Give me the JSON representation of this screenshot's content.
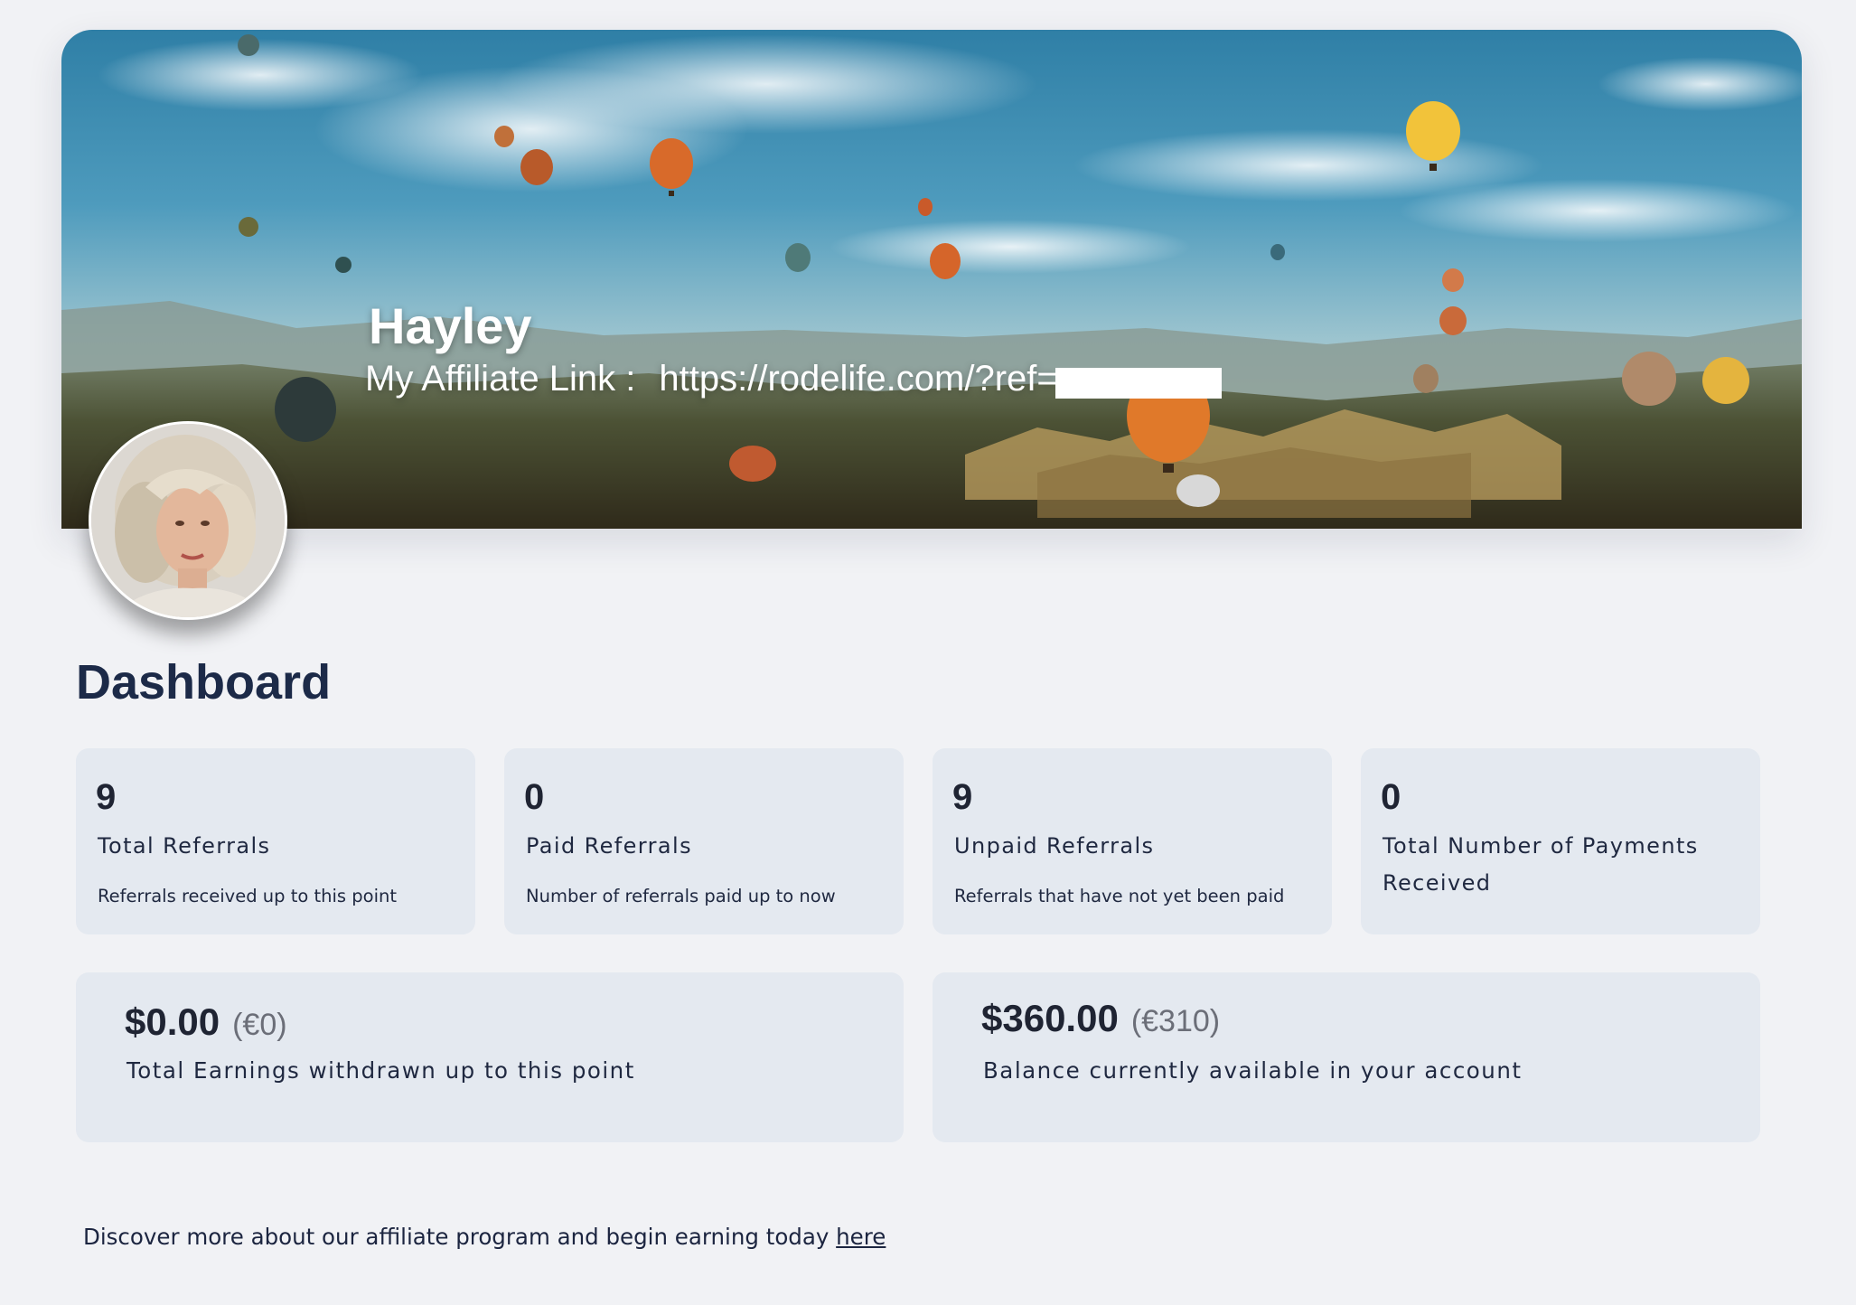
{
  "profile": {
    "name": "Hayley",
    "affiliate_link_label": "My Affiliate Link :",
    "affiliate_link_url": "https://rodelife.com/?ref="
  },
  "dashboard": {
    "title": "Dashboard",
    "stats": [
      {
        "value": "9",
        "label": "Total Referrals",
        "description": "Referrals received up to this point"
      },
      {
        "value": "0",
        "label": "Paid Referrals",
        "description": "Number of referrals paid up to now"
      },
      {
        "value": "9",
        "label": "Unpaid Referrals",
        "description": "Referrals that have not yet been paid"
      },
      {
        "value": "0",
        "label": "Total Number of Payments Received",
        "description": ""
      }
    ],
    "earnings": [
      {
        "amount": "$0.00",
        "converted": "(€0)",
        "label": "Total Earnings withdrawn up to this point"
      },
      {
        "amount": "$360.00",
        "converted": "(€310)",
        "label": "Balance currently available in your account"
      }
    ]
  },
  "footer": {
    "text": "Discover more about our affiliate program and begin earning today ",
    "link_label": "here"
  },
  "colors": {
    "page_background": "#f1f2f5",
    "card_background": "#e4e9f0",
    "heading": "#1c2a48",
    "text": "#1f2840",
    "muted": "#6b6e78"
  }
}
